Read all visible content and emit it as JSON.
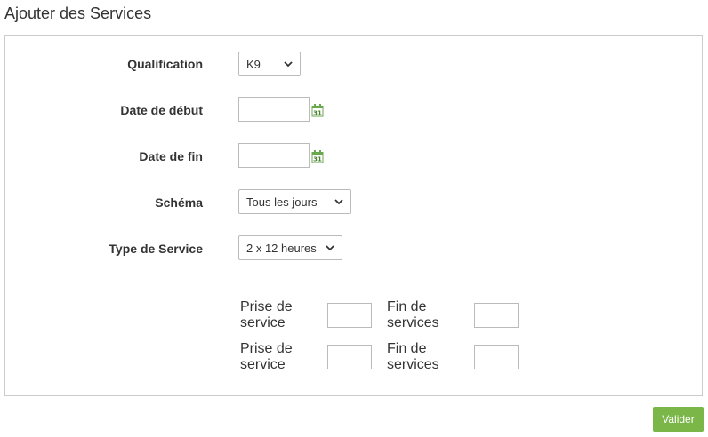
{
  "page": {
    "title": "Ajouter des Services"
  },
  "form": {
    "qualification": {
      "label": "Qualification",
      "value": "K9"
    },
    "date_debut": {
      "label": "Date de début",
      "value": ""
    },
    "date_fin": {
      "label": "Date de fin",
      "value": ""
    },
    "schema": {
      "label": "Schéma",
      "value": "Tous les jours"
    },
    "type_service": {
      "label": "Type de Service",
      "value": "2 x 12 heures"
    },
    "shifts": [
      {
        "prise_line1": "Prise de",
        "prise_line2": "service",
        "fin_line1": "Fin de",
        "fin_line2": "services",
        "prise_value": "",
        "fin_value": ""
      },
      {
        "prise_line1": "Prise de",
        "prise_line2": "service",
        "fin_line1": "Fin de",
        "fin_line2": "services",
        "prise_value": "",
        "fin_value": ""
      }
    ]
  },
  "actions": {
    "submit_label": "Valider"
  },
  "colors": {
    "accent": "#7ab648",
    "calendar_icon": "#6aa84f",
    "border": "#cccccc"
  },
  "icons": {
    "calendar": "calendar-icon",
    "dropdown": "chevron-down-icon"
  }
}
